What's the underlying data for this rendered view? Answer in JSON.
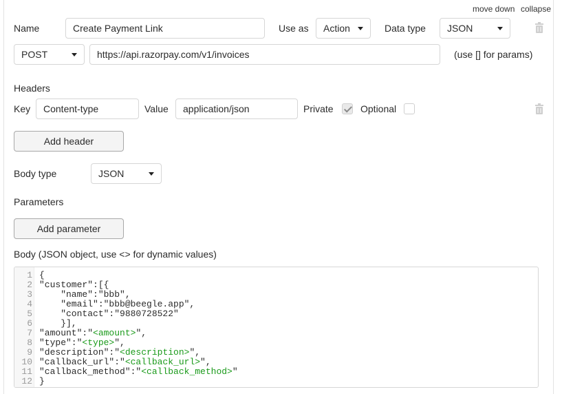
{
  "top_links": {
    "move_down": "move down",
    "collapse": "collapse"
  },
  "call": {
    "name_label": "Name",
    "name_value": "Create Payment Link",
    "use_as_label": "Use as",
    "use_as_value": "Action",
    "data_type_label": "Data type",
    "data_type_value": "JSON",
    "method_value": "POST",
    "url_value": "https://api.razorpay.com/v1/invoices",
    "params_hint": "(use [] for params)"
  },
  "headers": {
    "title": "Headers",
    "key_label": "Key",
    "key_value": "Content-type",
    "value_label": "Value",
    "value_value": "application/json",
    "private_label": "Private",
    "private_checked": true,
    "optional_label": "Optional",
    "optional_checked": false,
    "add_button": "Add header"
  },
  "body_type": {
    "label": "Body type",
    "value": "JSON"
  },
  "parameters": {
    "title": "Parameters",
    "add_button": "Add parameter"
  },
  "body": {
    "label": "Body (JSON object, use <> for dynamic values)",
    "lines": [
      {
        "n": "1",
        "parts": [
          {
            "t": "{",
            "d": false
          }
        ]
      },
      {
        "n": "2",
        "parts": [
          {
            "t": "\"customer\":[{",
            "d": false
          }
        ]
      },
      {
        "n": "3",
        "parts": [
          {
            "t": "    \"name\":\"bbb\",",
            "d": false
          }
        ]
      },
      {
        "n": "4",
        "parts": [
          {
            "t": "    \"email\":\"bbb@beegle.app\",",
            "d": false
          }
        ]
      },
      {
        "n": "5",
        "parts": [
          {
            "t": "    \"contact\":\"9880728522\"",
            "d": false
          }
        ]
      },
      {
        "n": "6",
        "parts": [
          {
            "t": "    }],",
            "d": false
          }
        ]
      },
      {
        "n": "7",
        "parts": [
          {
            "t": "\"amount\":\"",
            "d": false
          },
          {
            "t": "<amount>",
            "d": true
          },
          {
            "t": "\",",
            "d": false
          }
        ]
      },
      {
        "n": "8",
        "parts": [
          {
            "t": "\"type\":\"",
            "d": false
          },
          {
            "t": "<type>",
            "d": true
          },
          {
            "t": "\",",
            "d": false
          }
        ]
      },
      {
        "n": "9",
        "parts": [
          {
            "t": "\"description\":\"",
            "d": false
          },
          {
            "t": "<description>",
            "d": true
          },
          {
            "t": "\",",
            "d": false
          }
        ]
      },
      {
        "n": "10",
        "parts": [
          {
            "t": "\"callback_url\":\"",
            "d": false
          },
          {
            "t": "<callback_url>",
            "d": true
          },
          {
            "t": "\",",
            "d": false
          }
        ]
      },
      {
        "n": "11",
        "parts": [
          {
            "t": "\"callback_method\":\"",
            "d": false
          },
          {
            "t": "<callback_method>",
            "d": true
          },
          {
            "t": "\"",
            "d": false
          }
        ]
      },
      {
        "n": "12",
        "parts": [
          {
            "t": "}",
            "d": false
          }
        ]
      }
    ]
  },
  "icons": {
    "delete_call": "trash-icon",
    "delete_header": "trash-icon"
  }
}
